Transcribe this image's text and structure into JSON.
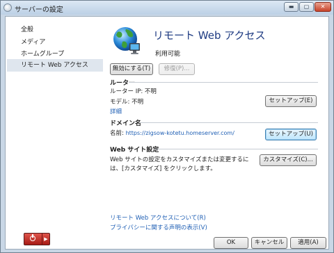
{
  "window": {
    "title": "サーバーの設定",
    "controls": {
      "minimize": "▬",
      "maximize": "▢",
      "close": "✕"
    }
  },
  "sidebar": {
    "items": [
      {
        "label": "全般"
      },
      {
        "label": "メディア"
      },
      {
        "label": "ホームグループ"
      },
      {
        "label": "リモート Web アクセス",
        "selected": true
      }
    ]
  },
  "header": {
    "title": "リモート Web アクセス",
    "status": "利用可能",
    "icon": "globe-network-icon"
  },
  "actions": {
    "disable_label": "無効にする(T)",
    "repair_label": "修復(P)..."
  },
  "router": {
    "heading": "ルーター",
    "ip_line": "ルーター IP: 不明",
    "model_line": "モデル: 不明",
    "details_link": "詳細",
    "setup_button": "セットアップ(E)"
  },
  "domain": {
    "heading": "ドメイン名",
    "name_label": "名前:",
    "name_value": "https://zigsow-kotetu.homeserver.com/",
    "setup_button": "セットアップ(U)"
  },
  "website": {
    "heading": "Web サイト設定",
    "description_line1": "Web サイトの設定をカスタマイズまたは変更するに",
    "description_line2": "は、[カスタマイズ] をクリックします。",
    "customize_button": "カスタマイズ(C)..."
  },
  "links": {
    "about": "リモート Web アクセスについて(R)",
    "privacy": "プライバシーに関する声明の表示(V)"
  },
  "footer": {
    "ok": "OK",
    "cancel": "キャンセル",
    "apply": "適用(A)"
  },
  "power_menu": {
    "icon": "power-icon",
    "arrow": "▶"
  },
  "colors": {
    "title_blue": "#1e3b82",
    "link_blue": "#1f5fb4",
    "selection": "#dfe6ee",
    "power_red": "#c62a22"
  }
}
